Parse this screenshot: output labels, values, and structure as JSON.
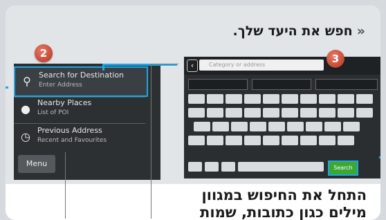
{
  "title": "חפש את היעד שלך.",
  "title_chevron": "«",
  "bottom_text_line1": "התחל את החיפוש במגוון",
  "bottom_text_line2": "מילים כגון כתובות, שמות",
  "badges": {
    "left": "2",
    "right": "3"
  },
  "menu": {
    "items": [
      {
        "icon": "search-icon",
        "label": "Search for Destination",
        "sub": "Enter Address"
      },
      {
        "icon": "pin-icon",
        "label": "Nearby Places",
        "sub": "List of POI"
      },
      {
        "icon": "clock-icon",
        "label": "Previous Address",
        "sub": "Recent and Favourites"
      }
    ],
    "menu_button": "Menu"
  },
  "keyboard": {
    "placeholder": "Category or address",
    "search_label": "Search"
  },
  "colors": {
    "accent": "#1ea7e4",
    "badge": "#c24a34",
    "search_green": "#3aa832"
  }
}
